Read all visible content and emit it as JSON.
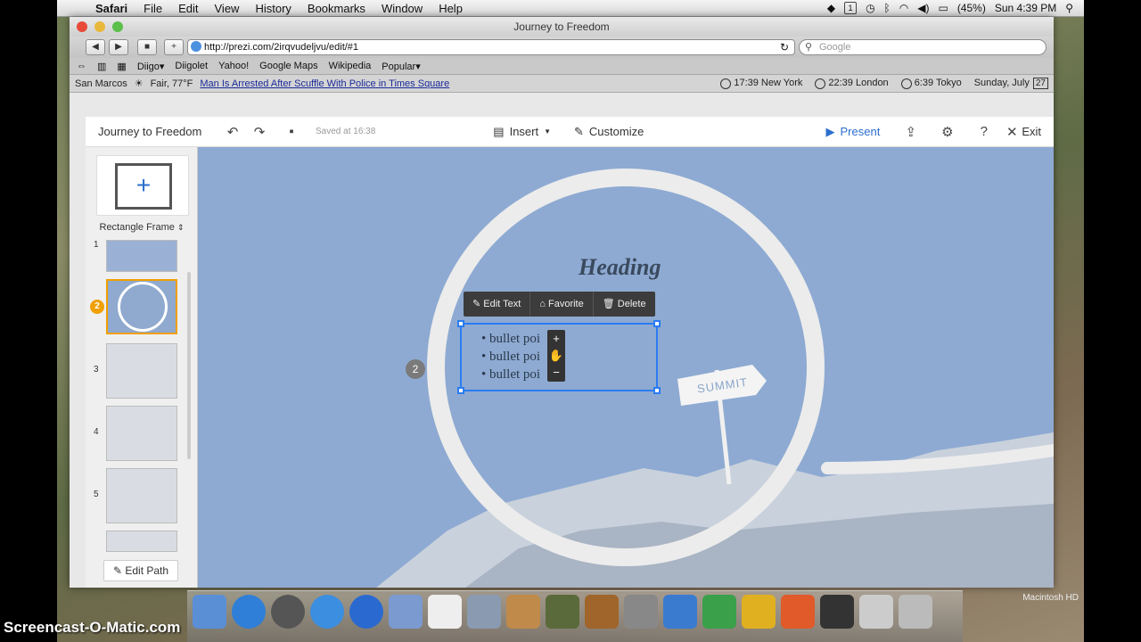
{
  "menubar": {
    "items": [
      "Safari",
      "File",
      "Edit",
      "View",
      "History",
      "Bookmarks",
      "Window",
      "Help"
    ],
    "battery": "(45%)",
    "clock": "Sun 4:39 PM"
  },
  "window": {
    "title": "Journey to Freedom",
    "url": "http://prezi.com/2irqvudeljvu/edit/#1",
    "search_placeholder": "Google"
  },
  "bookmarks": [
    "Diigo▾",
    "Diigolet",
    "Yahoo!",
    "Google Maps",
    "Wikipedia",
    "Popular▾"
  ],
  "newsbar": {
    "location": "San Marcos",
    "weather": "Fair, 77°F",
    "headline": "Man Is Arrested After Scuffle With Police in Times Square",
    "clocks": [
      "17:39 New York",
      "22:39 London",
      "6:39 Tokyo"
    ],
    "date": "Sunday, July",
    "day": "27"
  },
  "prezi": {
    "title": "Journey to Freedom",
    "saved": "Saved at 16:38",
    "insert_label": "Insert",
    "customize_label": "Customize",
    "present_label": "Present",
    "exit_label": "Exit",
    "frame_type": "Rectangle Frame",
    "thumbnails": [
      {
        "num": "1"
      },
      {
        "num": "2"
      },
      {
        "num": "3"
      },
      {
        "num": "4"
      },
      {
        "num": "5"
      }
    ],
    "edit_path_label": "Edit Path",
    "canvas": {
      "heading": "Heading",
      "ctx_edit_text": "Edit Text",
      "ctx_favorite": "Favorite",
      "ctx_delete": "Delete",
      "bullets": [
        "bullet poi",
        "bullet poi",
        "bullet poi"
      ],
      "path_number": "2",
      "signpost": "SUMMIT",
      "zoom_plus": "+",
      "zoom_minus": "−"
    }
  },
  "dock_label": "Macintosh HD",
  "watermark": "Screencast-O-Matic.com"
}
